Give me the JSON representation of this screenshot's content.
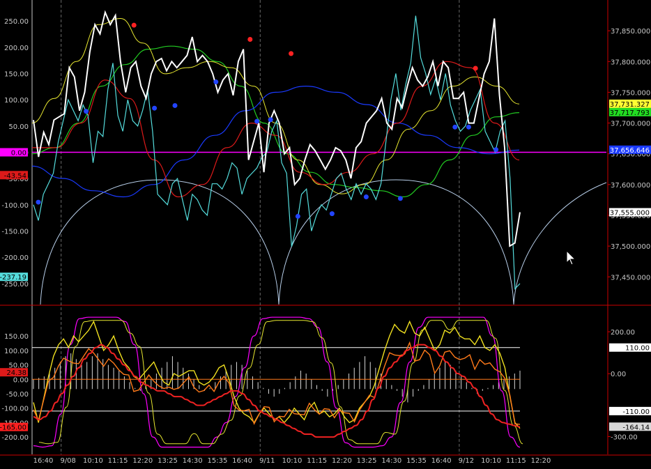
{
  "colors": {
    "background": "#000000",
    "axis": "#c8c8c8",
    "frame": "#cc0000",
    "price_white": "#ffffff",
    "cyan": "#55dddd",
    "yellow": "#e8e830",
    "green": "#22cc22",
    "red": "#dd1a1a",
    "blue": "#1a3aff",
    "lightblue": "#b8cfea",
    "magenta": "#ff00ff",
    "orange": "#ff7a1a",
    "purple": "#cc55cc",
    "gray": "#d8d8d8"
  },
  "chart_data": [
    {
      "type": "line",
      "left_axis": {
        "ylim": [
          -290,
          290
        ],
        "ticks": [
          "250.00",
          "200.00",
          "150.00",
          "100.00",
          "50.00",
          "0.00",
          "-50.00",
          "-100.00",
          "-150.00",
          "-200.00",
          "-250.00"
        ],
        "tick_values": [
          250,
          200,
          150,
          100,
          50,
          0,
          -50,
          -100,
          -150,
          -200,
          -250
        ]
      },
      "right_axis": {
        "ylim": [
          37405,
          37900
        ],
        "ticks": [
          "37,850.000",
          "37,800.000",
          "37,750.000",
          "37,700.000",
          "37,650.000",
          "37,600.000",
          "37,550.000",
          "37,500.000",
          "37,450.000"
        ],
        "tick_values": [
          37850,
          37800,
          37750,
          37700,
          37650,
          37600,
          37550,
          37500,
          37450
        ]
      },
      "left_markers": [
        {
          "label": "0.00",
          "value": 0,
          "color": "#ff00ff"
        },
        {
          "label": "-43.54",
          "value": -43.54,
          "color": "#dd1a1a"
        },
        {
          "label": "-237.19",
          "value": -237.19,
          "color": "#55dddd"
        }
      ],
      "right_markers": [
        {
          "label": "37,731.327",
          "value": 37731.327,
          "color": "#ffff33",
          "text": "#000000"
        },
        {
          "label": "37,717.793",
          "value": 37717.793,
          "color": "#22dd22",
          "text": "#000000"
        },
        {
          "label": "37,656.646",
          "value": 37656.646,
          "color": "#1a3aff",
          "text": "#ffffff"
        },
        {
          "label": "37,555.000",
          "value": 37555,
          "color": "#ffffff",
          "text": "#000000"
        }
      ],
      "zero_line": 0,
      "series": {
        "cyan_osc": [
          -100,
          -130,
          -80,
          -60,
          -40,
          20,
          60,
          100,
          80,
          60,
          90,
          70,
          -20,
          40,
          30,
          120,
          170,
          70,
          40,
          100,
          60,
          50,
          80,
          120,
          40,
          -80,
          -90,
          -100,
          -60,
          -50,
          -90,
          -130,
          -80,
          -90,
          -110,
          -120,
          -60,
          -60,
          -70,
          -50,
          -20,
          -30,
          -80,
          -50,
          -40,
          -30,
          -10,
          0,
          40,
          60,
          -20,
          -40,
          -180,
          -140,
          -80,
          -70,
          -150,
          -120,
          -100,
          -110,
          -80,
          -50,
          -40,
          -70,
          -90,
          -60,
          -80,
          -60,
          -70,
          -90,
          -60,
          20,
          100,
          150,
          80,
          130,
          170,
          260,
          180,
          150,
          110,
          140,
          100,
          150,
          90,
          60,
          40,
          50,
          80,
          100,
          120,
          40,
          20,
          0,
          40,
          60,
          -50,
          -260,
          -250
        ]
      },
      "price_series": {
        "white": [
          37705,
          37645,
          37685,
          37665,
          37705,
          37710,
          37715,
          37790,
          37775,
          37720,
          37750,
          37815,
          37860,
          37845,
          37880,
          37860,
          37875,
          37800,
          37750,
          37790,
          37800,
          37760,
          37740,
          37780,
          37800,
          37805,
          37785,
          37800,
          37790,
          37800,
          37810,
          37840,
          37800,
          37810,
          37800,
          37780,
          37750,
          37770,
          37780,
          37745,
          37800,
          37820,
          37640,
          37670,
          37700,
          37620,
          37700,
          37720,
          37700,
          37650,
          37660,
          37600,
          37610,
          37640,
          37665,
          37655,
          37640,
          37625,
          37640,
          37660,
          37655,
          37640,
          37610,
          37660,
          37670,
          37700,
          37710,
          37720,
          37740,
          37700,
          37690,
          37740,
          37725,
          37760,
          37790,
          37770,
          37760,
          37775,
          37800,
          37760,
          37800,
          37790,
          37740,
          37740,
          37750,
          37700,
          37700,
          37740,
          37780,
          37800,
          37870,
          37745,
          37660,
          37500,
          37505,
          37555
        ]
      },
      "dots": {
        "red": [
          {
            "x": 14,
            "y": 242
          },
          {
            "x": 31,
            "y": 215
          },
          {
            "x": 37,
            "y": 188
          },
          {
            "x": 64,
            "y": 160
          }
        ],
        "blue": [
          {
            "x": 0,
            "y": -95
          },
          {
            "x": 7,
            "y": 78
          },
          {
            "x": 17,
            "y": 84
          },
          {
            "x": 20,
            "y": 89
          },
          {
            "x": 26,
            "y": 134
          },
          {
            "x": 32,
            "y": 59
          },
          {
            "x": 34,
            "y": 62
          },
          {
            "x": 38,
            "y": -122
          },
          {
            "x": 43,
            "y": -117
          },
          {
            "x": 48,
            "y": -85
          },
          {
            "x": 53,
            "y": -88
          },
          {
            "x": 61,
            "y": 48
          },
          {
            "x": 63,
            "y": 48
          },
          {
            "x": 67,
            "y": 5
          }
        ]
      }
    },
    {
      "type": "line",
      "left_axis": {
        "ylim": [
          -260,
          230
        ],
        "ticks": [
          "150.00",
          "100.00",
          "50.00",
          "0.00",
          "-50.00",
          "-100.00",
          "-150.00",
          "-200.00"
        ],
        "tick_values": [
          150,
          100,
          50,
          0,
          -50,
          -100,
          -150,
          -200
        ]
      },
      "right_axis": {
        "ylim": [
          -385,
          290
        ],
        "ticks": [
          "200.00",
          "0.00",
          "-300.00"
        ],
        "tick_values": [
          200,
          0,
          -300
        ]
      },
      "left_markers": [
        {
          "label": "24.38",
          "value": 24.38,
          "color": "#dd1a1a"
        },
        {
          "label": "-165.00",
          "value": -165,
          "color": "#ff2020"
        }
      ],
      "right_markers": [
        {
          "label": "110.00",
          "value": 110,
          "color": "#ffffff",
          "text": "#000000"
        },
        {
          "label": "-110.00",
          "value": -110,
          "color": "#ffffff",
          "text": "#000000"
        },
        {
          "label": "-164.14",
          "value": -164.14,
          "color": "#d8d8d8",
          "text": "#000000"
        }
      ],
      "hlines_white": [
        110,
        -110
      ],
      "hline_orange": 0,
      "series": {
        "yellow_osc": [
          -80,
          -150,
          -70,
          10,
          80,
          120,
          140,
          110,
          150,
          130,
          150,
          170,
          200,
          150,
          100,
          120,
          150,
          100,
          60,
          40,
          10,
          0,
          20,
          40,
          60,
          20,
          -10,
          -20,
          20,
          10,
          20,
          30,
          30,
          -10,
          -20,
          -10,
          10,
          40,
          50,
          0,
          -60,
          -100,
          -120,
          -130,
          -150,
          -120,
          -100,
          -120,
          -140,
          -130,
          -150,
          -130,
          -100,
          -120,
          -140,
          -100,
          -80,
          -120,
          -110,
          -130,
          -120,
          -100,
          -130,
          -150,
          -140,
          -100,
          -80,
          -60,
          -20,
          40,
          100,
          150,
          190,
          170,
          160,
          200,
          160,
          150,
          180,
          140,
          100,
          120,
          170,
          160,
          180,
          150,
          140,
          140,
          120,
          150,
          110,
          100,
          120,
          90,
          40,
          -60,
          -150,
          -170
        ]
      },
      "smooth_orange": [
        -130,
        -140,
        -130,
        -110,
        -80,
        -50,
        -20,
        10,
        40,
        70,
        90,
        110,
        120,
        110,
        90,
        70,
        50,
        30,
        10,
        -10,
        -20,
        -30,
        -40,
        -40,
        -50,
        -60,
        -60,
        -70,
        -80,
        -90,
        -90,
        -80,
        -70,
        -60,
        -50,
        -40,
        -40,
        -50,
        -70,
        -90,
        -110,
        -120,
        -130,
        -140,
        -150,
        -160,
        -170,
        -180,
        -190,
        -190,
        -200,
        -200,
        -200,
        -200,
        -190,
        -180,
        -170,
        -160,
        -140,
        -110,
        -70,
        -30,
        10,
        40,
        60,
        80,
        100,
        110,
        120,
        120,
        110,
        100,
        80,
        60,
        40,
        20,
        10,
        -10,
        -30,
        -60,
        -90,
        -120,
        -140,
        -150,
        -155,
        -160,
        -165
      ],
      "histogram": [
        0,
        5,
        10,
        20,
        40,
        60,
        80,
        90,
        70,
        50,
        60,
        80,
        90,
        70,
        50,
        40,
        30,
        10,
        -10,
        -30,
        -40,
        -20,
        0,
        20,
        40,
        60,
        80,
        60,
        40,
        20,
        0,
        -20,
        -40,
        -30,
        -10,
        10,
        30,
        50,
        60,
        50,
        30,
        10,
        -10,
        -30,
        -50,
        -60,
        -50,
        -30,
        -10,
        10,
        30,
        20,
        0,
        -20,
        -40,
        -60,
        -40,
        -20,
        0,
        20,
        40,
        60,
        80,
        60,
        40,
        20,
        0,
        -20,
        -40,
        -60,
        -80,
        -60,
        -40,
        -20,
        0,
        20,
        40,
        60,
        50,
        30,
        10,
        -10,
        -30,
        -50,
        -40,
        -30,
        -20,
        -10,
        0,
        10,
        20,
        30
      ]
    }
  ],
  "x_labels": [
    "16:40",
    "9/08",
    "10:10",
    "11:15",
    "12:20",
    "13:25",
    "14:30",
    "15:35",
    "16:40",
    "9/11",
    "10:10",
    "11:15",
    "12:20",
    "13:25",
    "14:30",
    "15:35",
    "16:40",
    "9/12",
    "10:10",
    "11:15",
    "12:20"
  ]
}
